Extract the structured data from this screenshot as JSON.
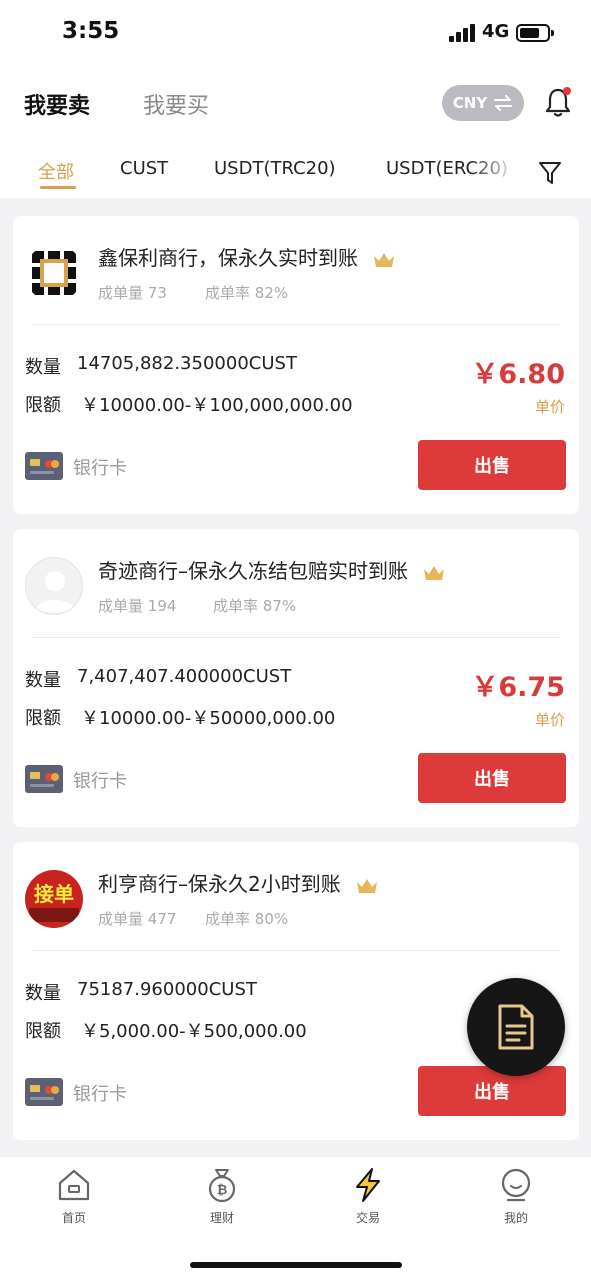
{
  "status_bar": {
    "time": "3:55",
    "network": "4G",
    "battery_level": 0.65
  },
  "header": {
    "tab_sell": "我要卖",
    "tab_buy": "我要买",
    "currency_label": "CNY",
    "currency_icon": "swap-arrows-icon",
    "notification_icon": "bell-icon",
    "accent_color": "#d8a24a",
    "sell_color": "#dd3a3a"
  },
  "filters": [
    "全部",
    "CUST",
    "USDT(TRC20)",
    "USDT(ERC20)"
  ],
  "listings": [
    {
      "merchant": "鑫保利商行，保永久实时到账",
      "orders_label": "成单量",
      "orders": "73",
      "rate_label": "成单率",
      "rate": "82%",
      "qty_label": "数量",
      "qty": "14705,882.350000CUST",
      "limit_label": "限额",
      "limit": "￥10000.00-￥100,000,000.00",
      "price": "￥6.80",
      "unit_label": "单价",
      "payment": "银行卡",
      "action": "出售"
    },
    {
      "merchant": "奇迹商行–保永久冻结包赔实时到账",
      "orders_label": "成单量",
      "orders": "194",
      "rate_label": "成单率",
      "rate": "87%",
      "qty_label": "数量",
      "qty": "7,407,407.400000CUST",
      "limit_label": "限额",
      "limit": "￥10000.00-￥50000,000.00",
      "price": "￥6.75",
      "unit_label": "单价",
      "payment": "银行卡",
      "action": "出售"
    },
    {
      "merchant": "利亨商行–保永久2小时到账",
      "orders_label": "成单量",
      "orders": "477",
      "rate_label": "成单率",
      "rate": "80%",
      "qty_label": "数量",
      "qty": "75187.960000CUST",
      "limit_label": "限额",
      "limit": "￥5,000.00-￥500,000.00",
      "avatar_text": "接单",
      "payment": "银行卡",
      "action": "出售"
    }
  ],
  "nav": [
    {
      "label": "首页",
      "icon": "home-icon"
    },
    {
      "label": "理财",
      "icon": "bitcoin-bag-icon"
    },
    {
      "label": "交易",
      "icon": "lightning-icon"
    },
    {
      "label": "我的",
      "icon": "profile-icon"
    }
  ]
}
